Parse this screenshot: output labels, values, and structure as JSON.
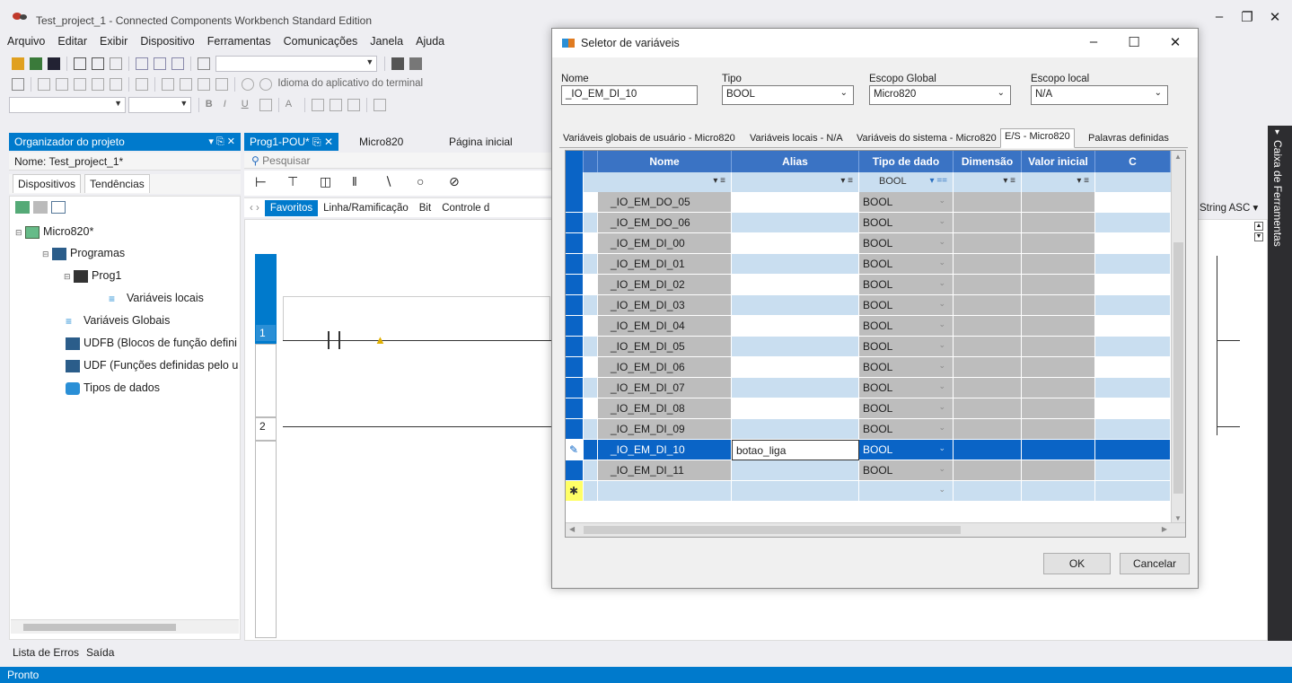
{
  "app": {
    "title": "Test_project_1 - Connected Components Workbench Standard Edition"
  },
  "menu": [
    "Arquivo",
    "Editar",
    "Exibir",
    "Dispositivo",
    "Ferramentas",
    "Comunicações",
    "Janela",
    "Ajuda"
  ],
  "toolbar": {
    "lang_label": "Idioma do aplicativo do terminal"
  },
  "project_organizer": {
    "title": "Organizador do projeto",
    "project_name": "Nome: Test_project_1*",
    "tabs": [
      "Dispositivos",
      "Tendências"
    ],
    "tree": [
      "Micro820*",
      "Programas",
      "Prog1",
      "Variáveis locais",
      "Variáveis Globais",
      "UDFB (Blocos de função defini",
      "UDF (Funções definidas pelo u",
      "Tipos de dados"
    ]
  },
  "document_tabs": [
    "Prog1-POU*",
    "Micro820",
    "Página inicial"
  ],
  "editor": {
    "search_placeholder": "Pesquisar",
    "categories": [
      "Favoritos",
      "Linha/Ramificação",
      "Bit",
      "Controle d"
    ],
    "rungs": [
      "1",
      "2"
    ],
    "string_combo": "String ASC"
  },
  "right_rail": "Caixa de Ferramentas",
  "bottom_tabs": [
    "Lista de Erros",
    "Saída"
  ],
  "status": "Pronto",
  "dialog": {
    "title": "Seletor de variáveis",
    "fields": {
      "nome_label": "Nome",
      "nome_value": "_IO_EM_DI_10",
      "tipo_label": "Tipo",
      "tipo_value": "BOOL",
      "escopo_global_label": "Escopo Global",
      "escopo_global_value": "Micro820",
      "escopo_local_label": "Escopo local",
      "escopo_local_value": "N/A"
    },
    "tabs": [
      "Variáveis globais de usuário - Micro820",
      "Variáveis locais - N/A",
      "Variáveis do sistema - Micro820",
      "E/S - Micro820",
      "Palavras definidas"
    ],
    "columns": [
      "Nome",
      "Alias",
      "Tipo de dado",
      "Dimensão",
      "Valor inicial",
      "C"
    ],
    "filter_type": "BOOL",
    "rows": [
      {
        "name": "_IO_EM_DO_05",
        "alias": "",
        "type": "BOOL"
      },
      {
        "name": "_IO_EM_DO_06",
        "alias": "",
        "type": "BOOL"
      },
      {
        "name": "_IO_EM_DI_00",
        "alias": "",
        "type": "BOOL"
      },
      {
        "name": "_IO_EM_DI_01",
        "alias": "",
        "type": "BOOL"
      },
      {
        "name": "_IO_EM_DI_02",
        "alias": "",
        "type": "BOOL"
      },
      {
        "name": "_IO_EM_DI_03",
        "alias": "",
        "type": "BOOL"
      },
      {
        "name": "_IO_EM_DI_04",
        "alias": "",
        "type": "BOOL"
      },
      {
        "name": "_IO_EM_DI_05",
        "alias": "",
        "type": "BOOL"
      },
      {
        "name": "_IO_EM_DI_06",
        "alias": "",
        "type": "BOOL"
      },
      {
        "name": "_IO_EM_DI_07",
        "alias": "",
        "type": "BOOL"
      },
      {
        "name": "_IO_EM_DI_08",
        "alias": "",
        "type": "BOOL"
      },
      {
        "name": "_IO_EM_DI_09",
        "alias": "",
        "type": "BOOL"
      },
      {
        "name": "_IO_EM_DI_10",
        "alias": "botao_liga",
        "type": "BOOL"
      },
      {
        "name": "_IO_EM_DI_11",
        "alias": "",
        "type": "BOOL"
      }
    ],
    "ok": "OK",
    "cancel": "Cancelar"
  },
  "colors": {
    "accent": "#007acc",
    "grid_header": "#3a73c4",
    "row_alt": "#c9def0",
    "selected": "#0a64c6"
  }
}
